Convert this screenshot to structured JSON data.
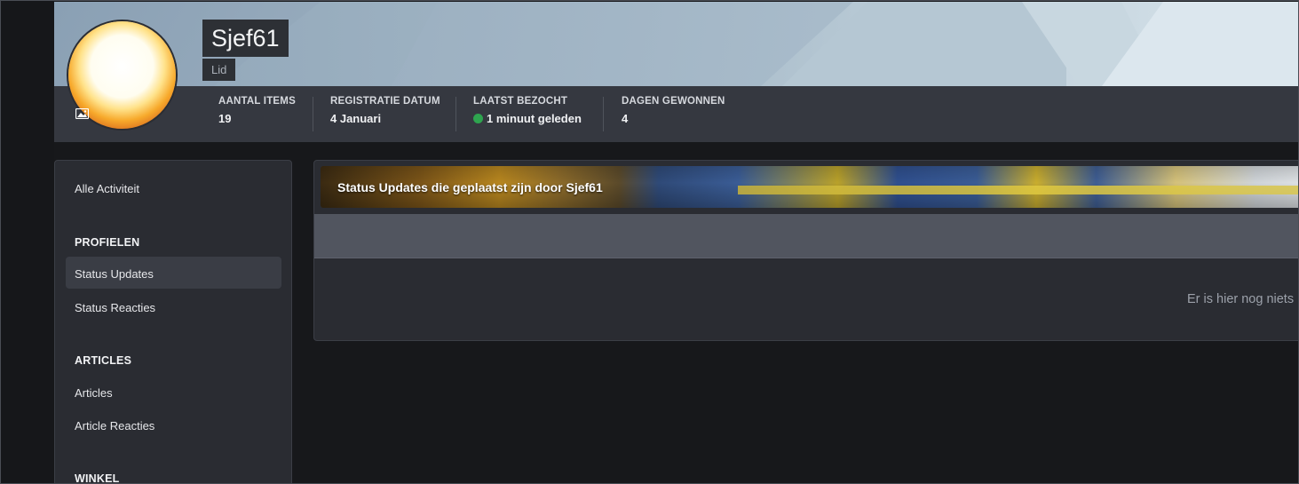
{
  "profile": {
    "name": "Sjef61",
    "role": "Lid",
    "stats": [
      {
        "label": "AANTAL ITEMS",
        "value": "19"
      },
      {
        "label": "REGISTRATIE DATUM",
        "value": "4 Januari"
      },
      {
        "label": "LAATST BEZOCHT",
        "value": "1 minuut geleden",
        "online": true
      },
      {
        "label": "DAGEN GEWONNEN",
        "value": "4"
      }
    ]
  },
  "sidebar": {
    "all_activity": "Alle Activiteit",
    "sections": [
      {
        "heading": "PROFIELEN",
        "items": [
          "Status Updates",
          "Status Reacties"
        ]
      },
      {
        "heading": "ARTICLES",
        "items": [
          "Articles",
          "Article Reacties"
        ]
      },
      {
        "heading": "WINKEL",
        "items": []
      }
    ],
    "active_item": "Status Updates"
  },
  "main": {
    "title": "Status Updates die geplaatst zijn door Sjef61",
    "empty_message": "Er is hier nog niets"
  },
  "colors": {
    "background": "#17181b",
    "panel": "#2a2c32",
    "online": "#2ea44f"
  }
}
